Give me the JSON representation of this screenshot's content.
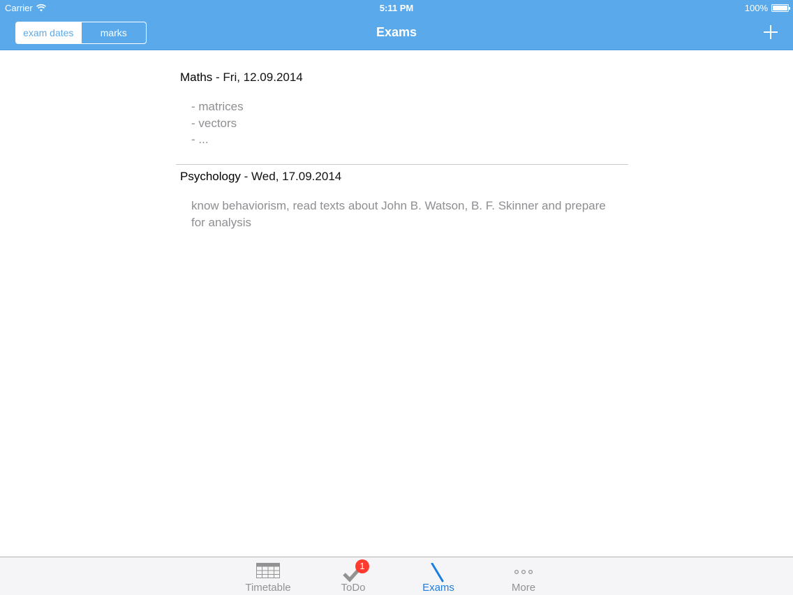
{
  "status_bar": {
    "carrier": "Carrier",
    "time": "5:11 PM",
    "battery": "100%"
  },
  "nav": {
    "segments": [
      {
        "label": "exam dates",
        "selected": true
      },
      {
        "label": "marks",
        "selected": false
      }
    ],
    "title": "Exams",
    "add_icon": "plus-icon"
  },
  "exams": [
    {
      "subject": "Maths",
      "date": " - Fri, 12.09.2014",
      "notes": [
        "- matrices",
        "- vectors",
        "- ..."
      ]
    },
    {
      "subject": "Psychology",
      "date": " - Wed, 17.09.2014",
      "notes": [
        "know behaviorism, read texts about John B. Watson, B. F. Skinner and prepare for analysis"
      ]
    }
  ],
  "tabs": [
    {
      "label": "Timetable",
      "icon": "table-icon",
      "active": false
    },
    {
      "label": "ToDo",
      "icon": "checkmark-icon",
      "active": false,
      "badge": "1"
    },
    {
      "label": "Exams",
      "icon": "pen-icon",
      "active": true
    },
    {
      "label": "More",
      "icon": "more-dots-icon",
      "active": false
    }
  ],
  "colors": {
    "header": "#5aaaeb",
    "active_tab": "#1a7ee0",
    "badge": "#ff3b30",
    "notes_text": "#8e8e93"
  }
}
